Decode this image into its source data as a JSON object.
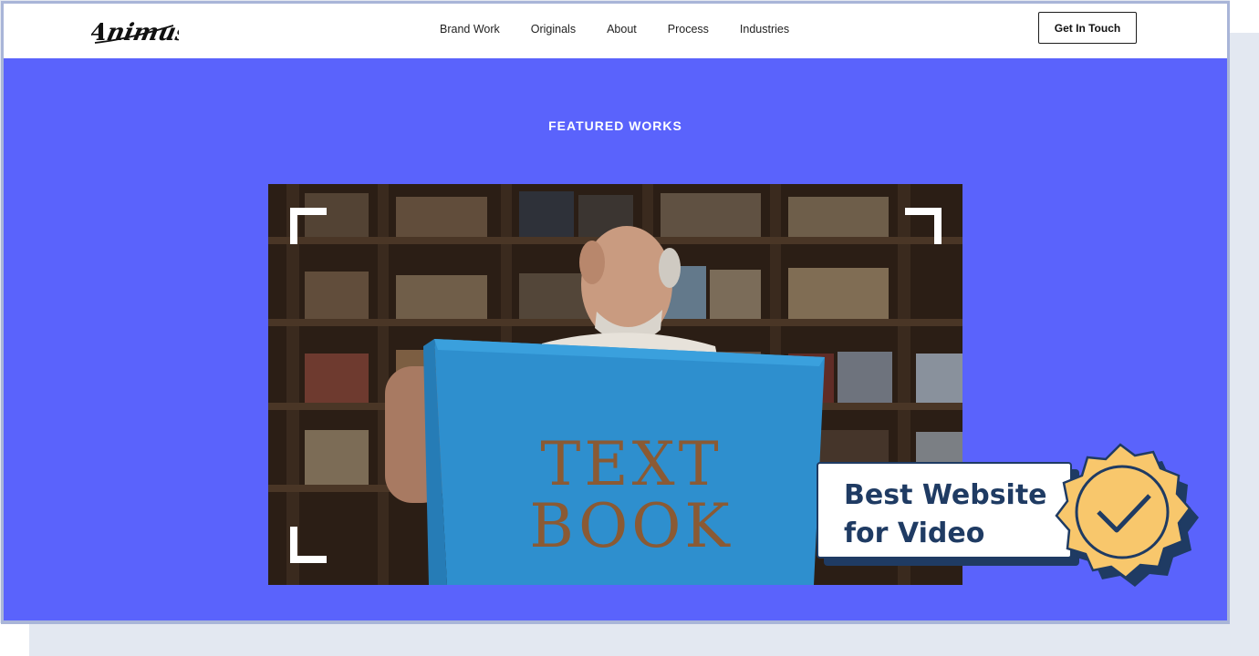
{
  "brand": {
    "logo_text": "Animus"
  },
  "nav": {
    "links": [
      "Brand Work",
      "Originals",
      "About",
      "Process",
      "Industries"
    ],
    "cta_label": "Get In Touch"
  },
  "hero": {
    "section_title": "FEATURED WORKS",
    "video_prop_text": [
      "TEXT",
      "BOOK"
    ]
  },
  "award": {
    "line1": "Best Website",
    "line2": "for Video"
  },
  "colors": {
    "hero_bg": "#5a63fc",
    "frame_border": "#a9b5d8",
    "award_navy": "#1f3b63",
    "badge_gold": "#f8c76c",
    "prop_blue": "#2e8fce"
  }
}
